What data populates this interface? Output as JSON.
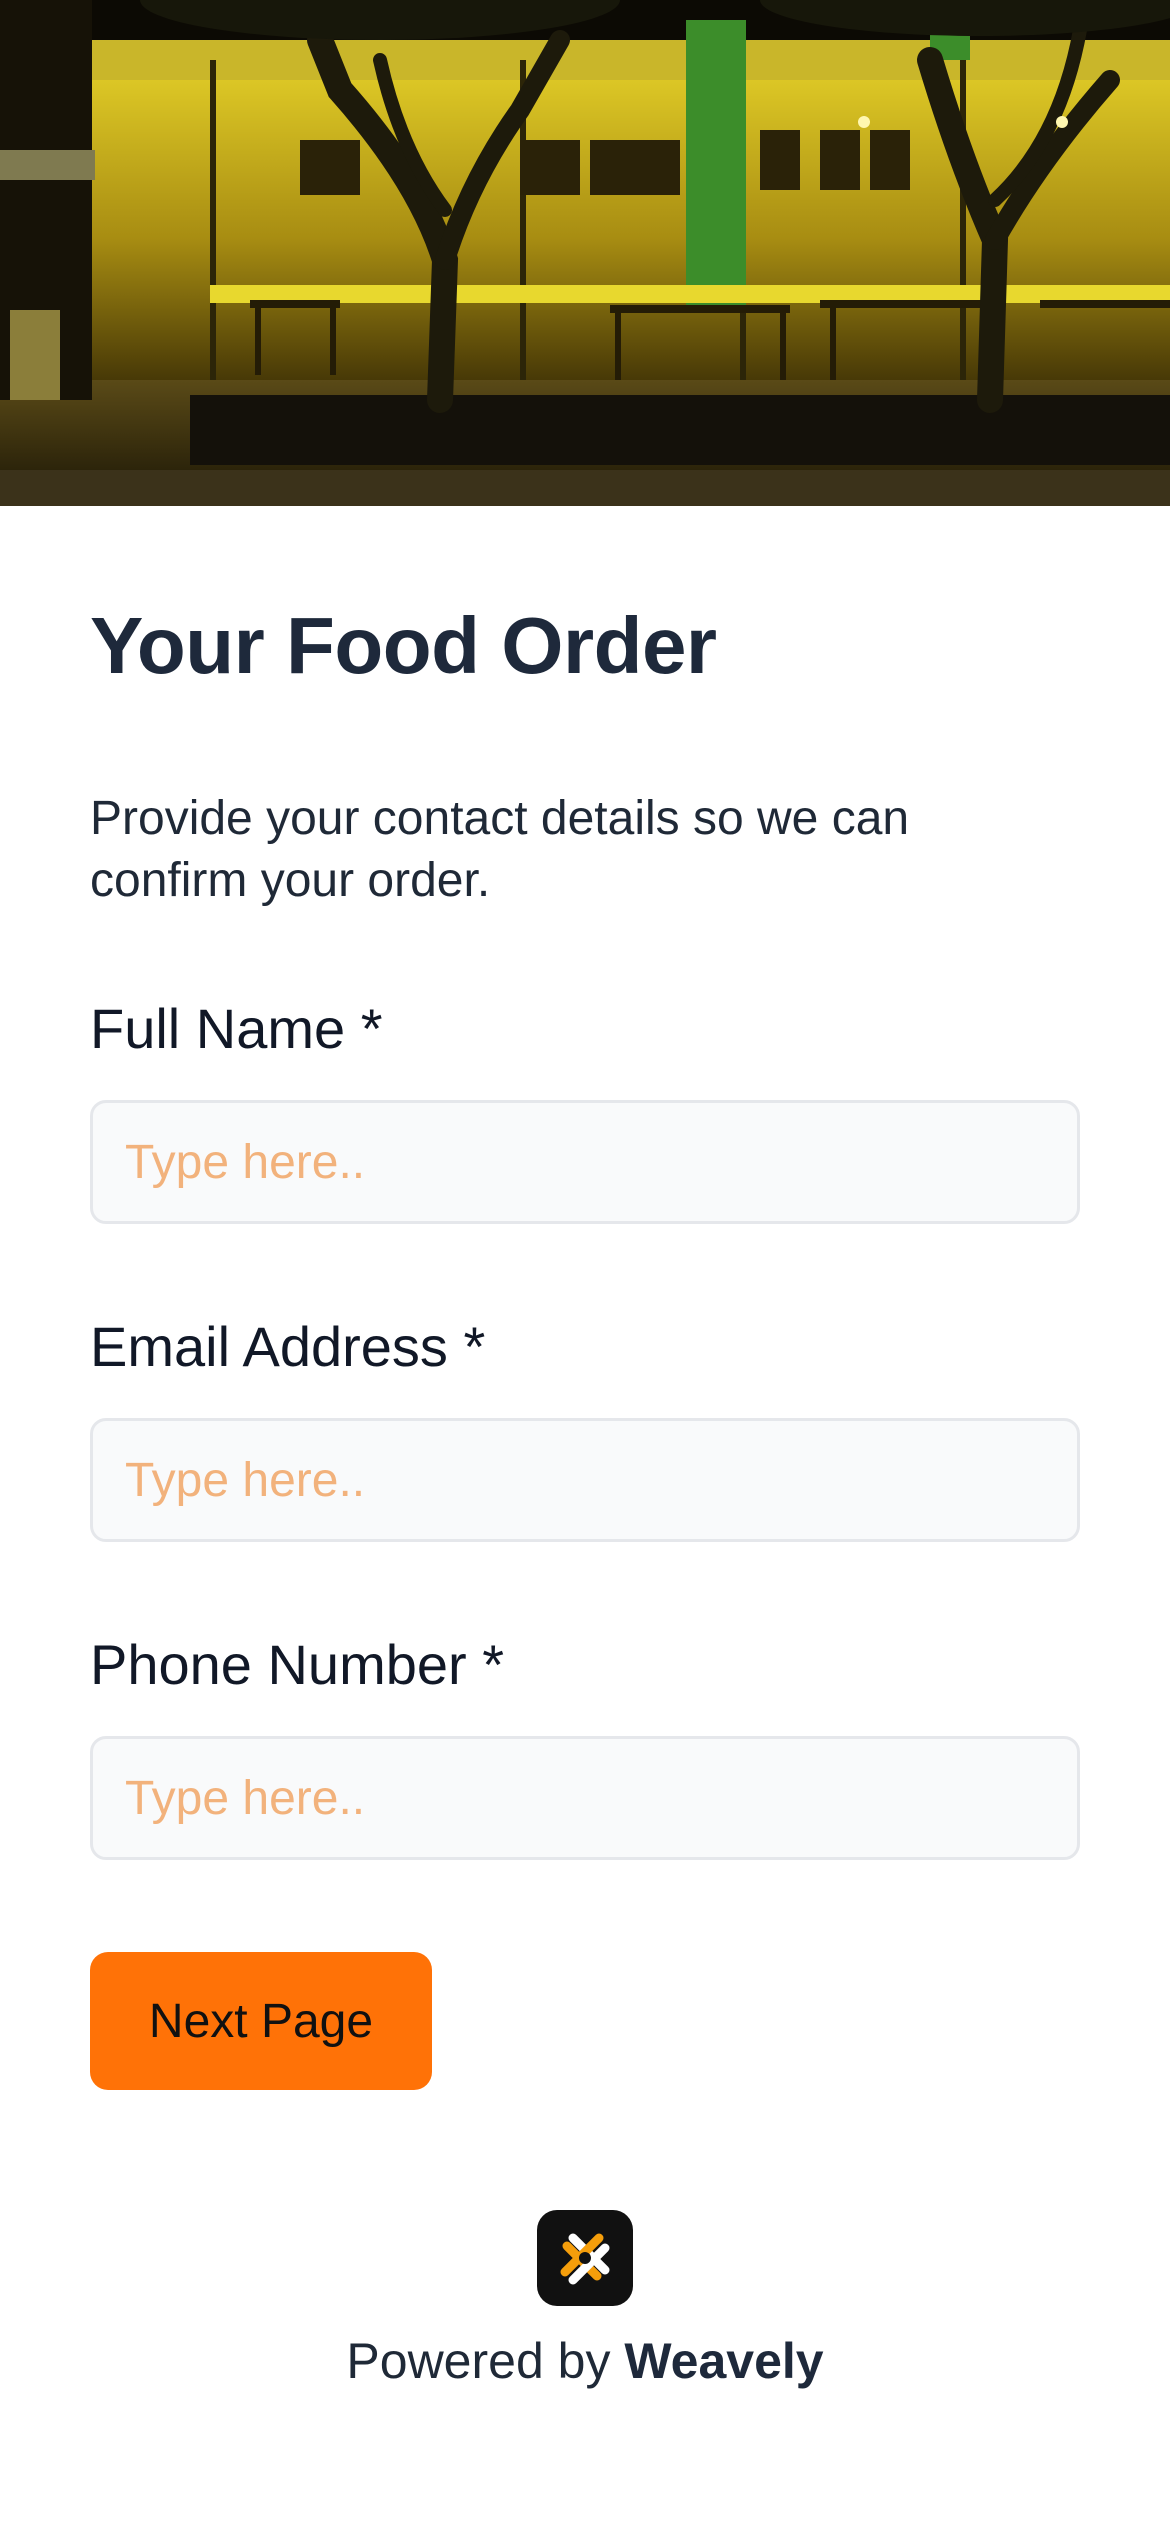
{
  "form": {
    "title": "Your Food Order",
    "description": "Provide your contact details so we can confirm your order.",
    "fields": [
      {
        "label": "Full Name *",
        "placeholder": "Type here..",
        "value": ""
      },
      {
        "label": "Email Address *",
        "placeholder": "Type here..",
        "value": ""
      },
      {
        "label": "Phone Number *",
        "placeholder": "Type here..",
        "value": ""
      }
    ],
    "next_button_label": "Next Page"
  },
  "footer": {
    "powered_by": "Powered by",
    "brand": "Weavely",
    "logo_icon": "weavely-logo-icon"
  },
  "colors": {
    "accent": "#ff7207",
    "placeholder": "#f2b27c",
    "input_bg": "#f9fafb",
    "input_border": "#e5e7eb",
    "heading": "#1e293b"
  }
}
